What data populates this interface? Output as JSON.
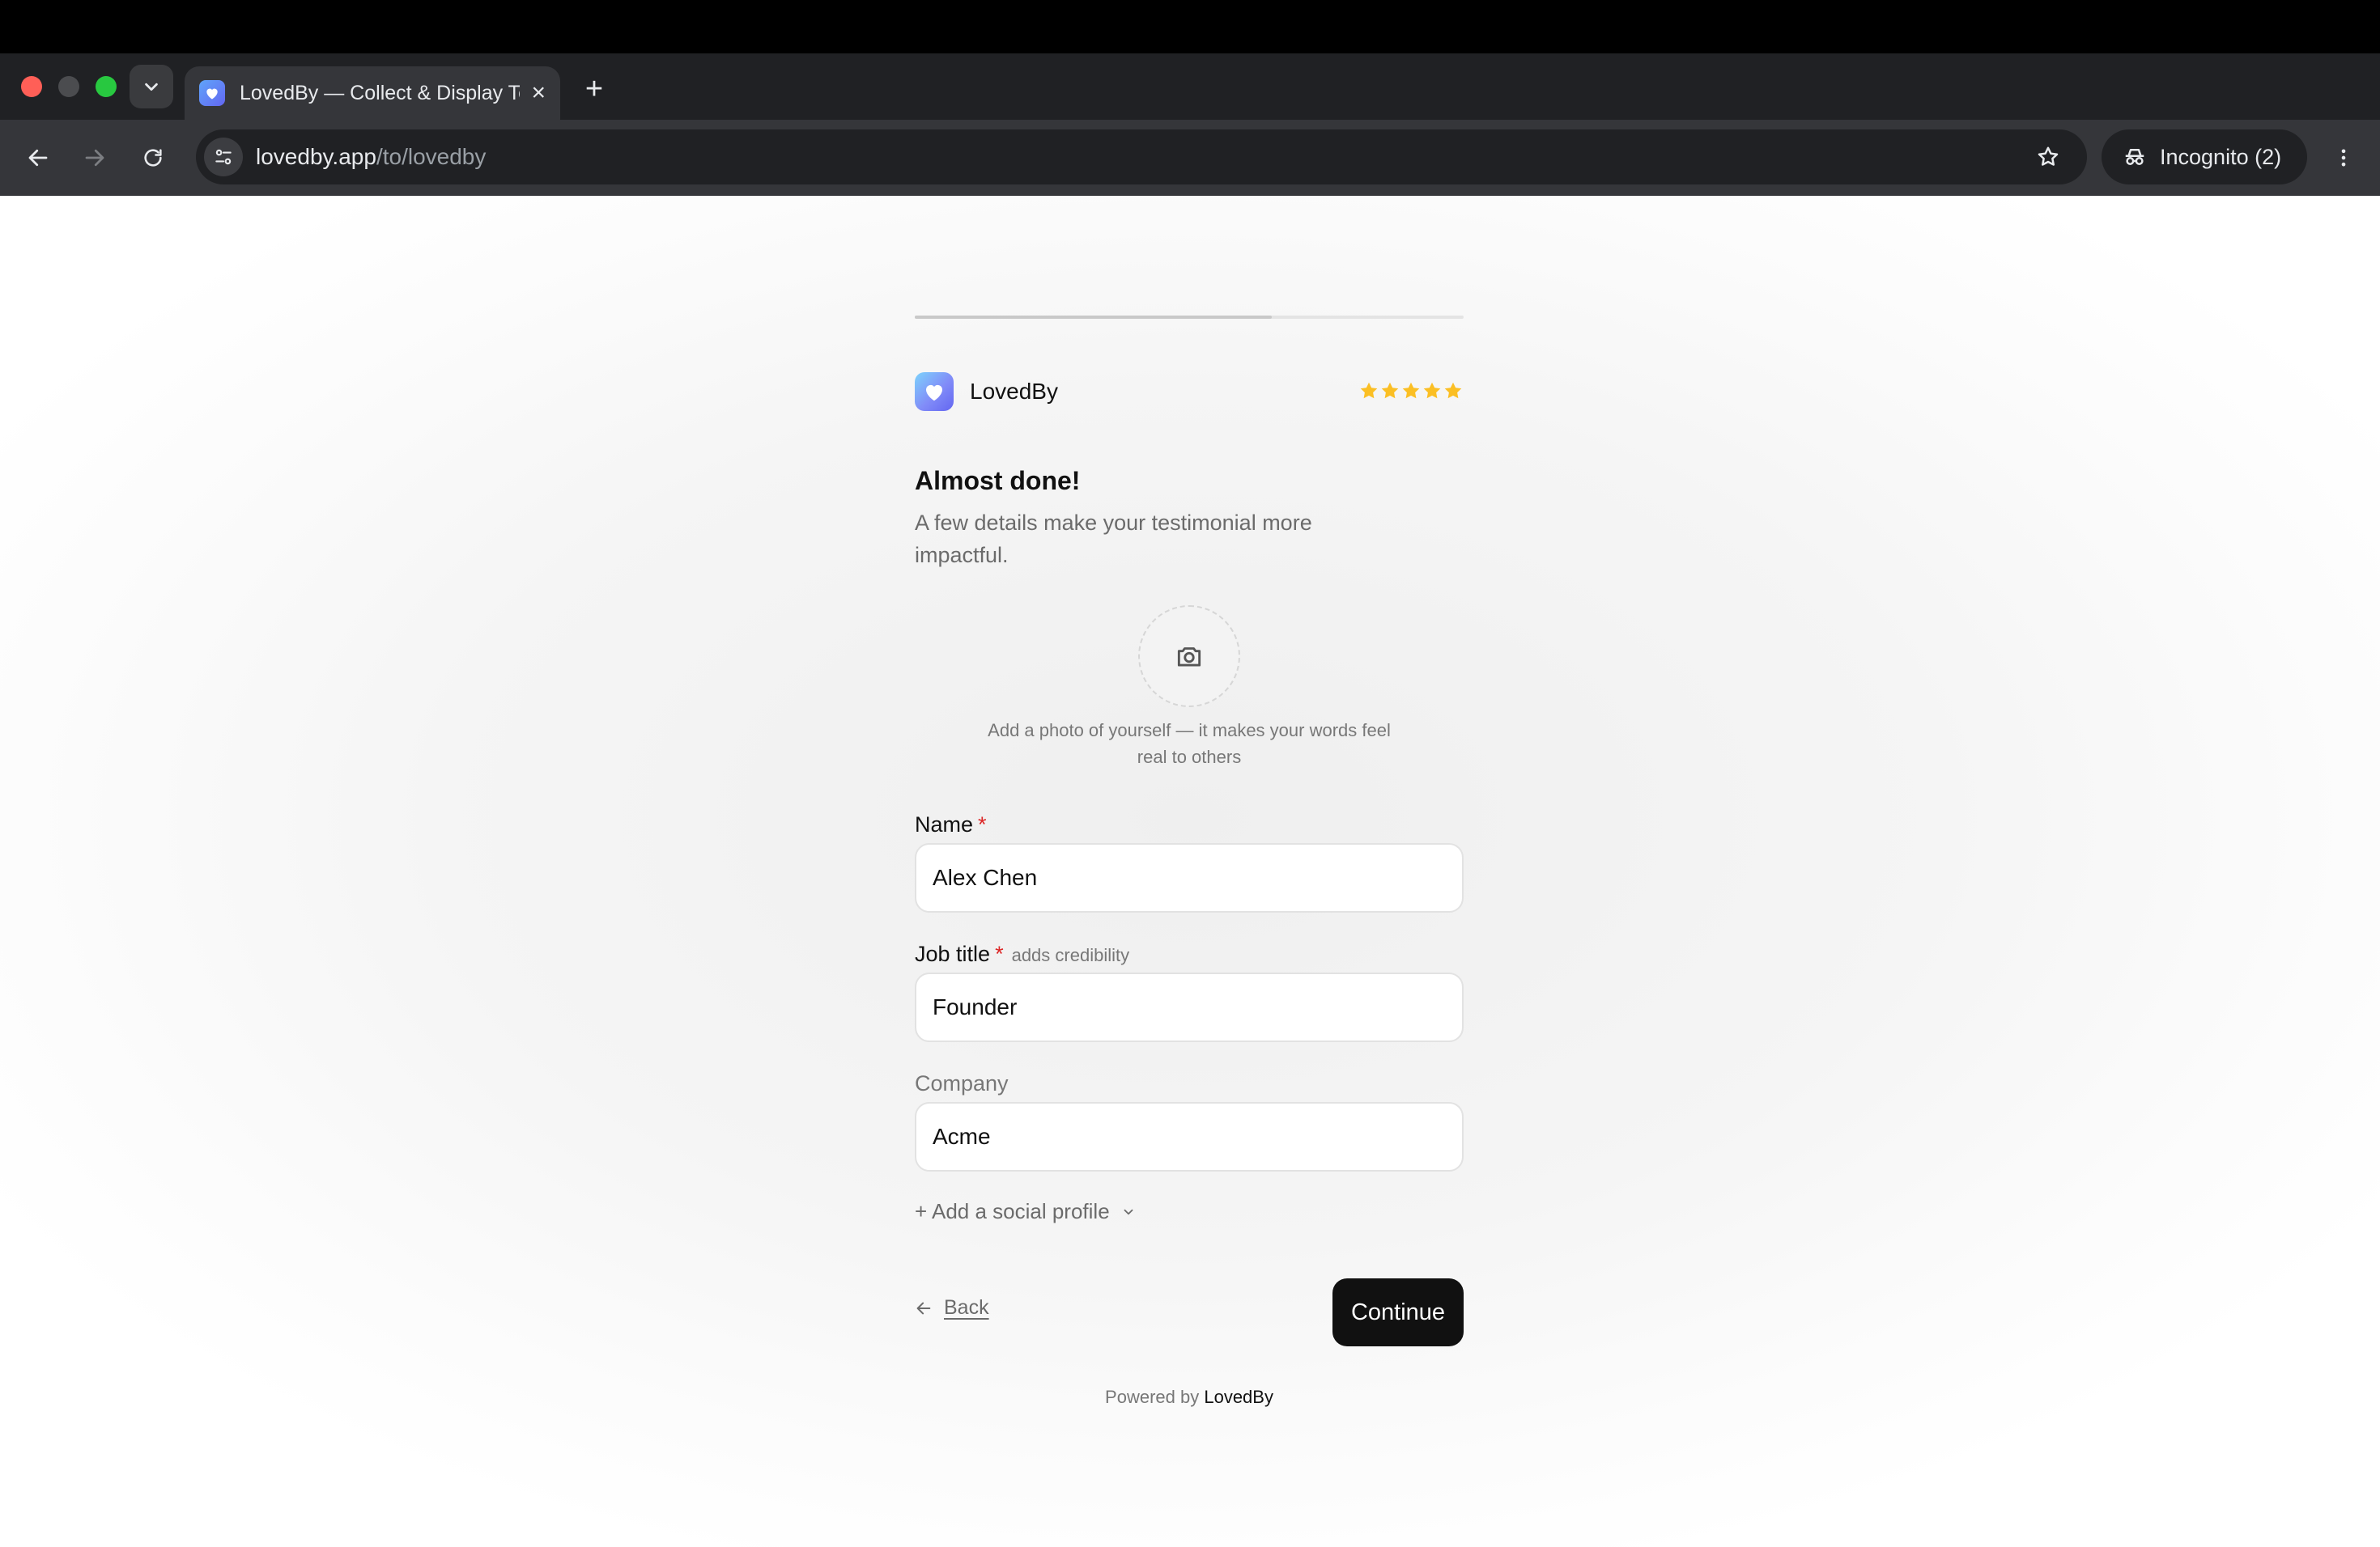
{
  "browser": {
    "tab_title": "LovedBy — Collect & Display Testimonials",
    "url_host": "lovedby.app",
    "url_path": "/to/lovedby",
    "incognito_label": "Incognito (2)"
  },
  "form": {
    "progress": 0.65,
    "brand_name": "LovedBy",
    "rating": 5,
    "heading": "Almost done!",
    "subheading": "A few details make your testimonial more impactful.",
    "photo_hint": "Add a photo of yourself — it makes your words feel real to others",
    "fields": {
      "name": {
        "label": "Name",
        "required_mark": "*",
        "value": "Alex Chen"
      },
      "job_title": {
        "label": "Job title",
        "required_mark": "*",
        "hint": "adds credibility",
        "value": "Founder"
      },
      "company": {
        "label": "Company",
        "value": "Acme"
      }
    },
    "social_label": "+ Add a social profile",
    "back_label": "Back",
    "continue_label": "Continue",
    "powered_prefix": "Powered by",
    "powered_brand": "LovedBy"
  },
  "colors": {
    "accent": "#111111",
    "required": "#dc2626",
    "star": "#fbbf24"
  }
}
